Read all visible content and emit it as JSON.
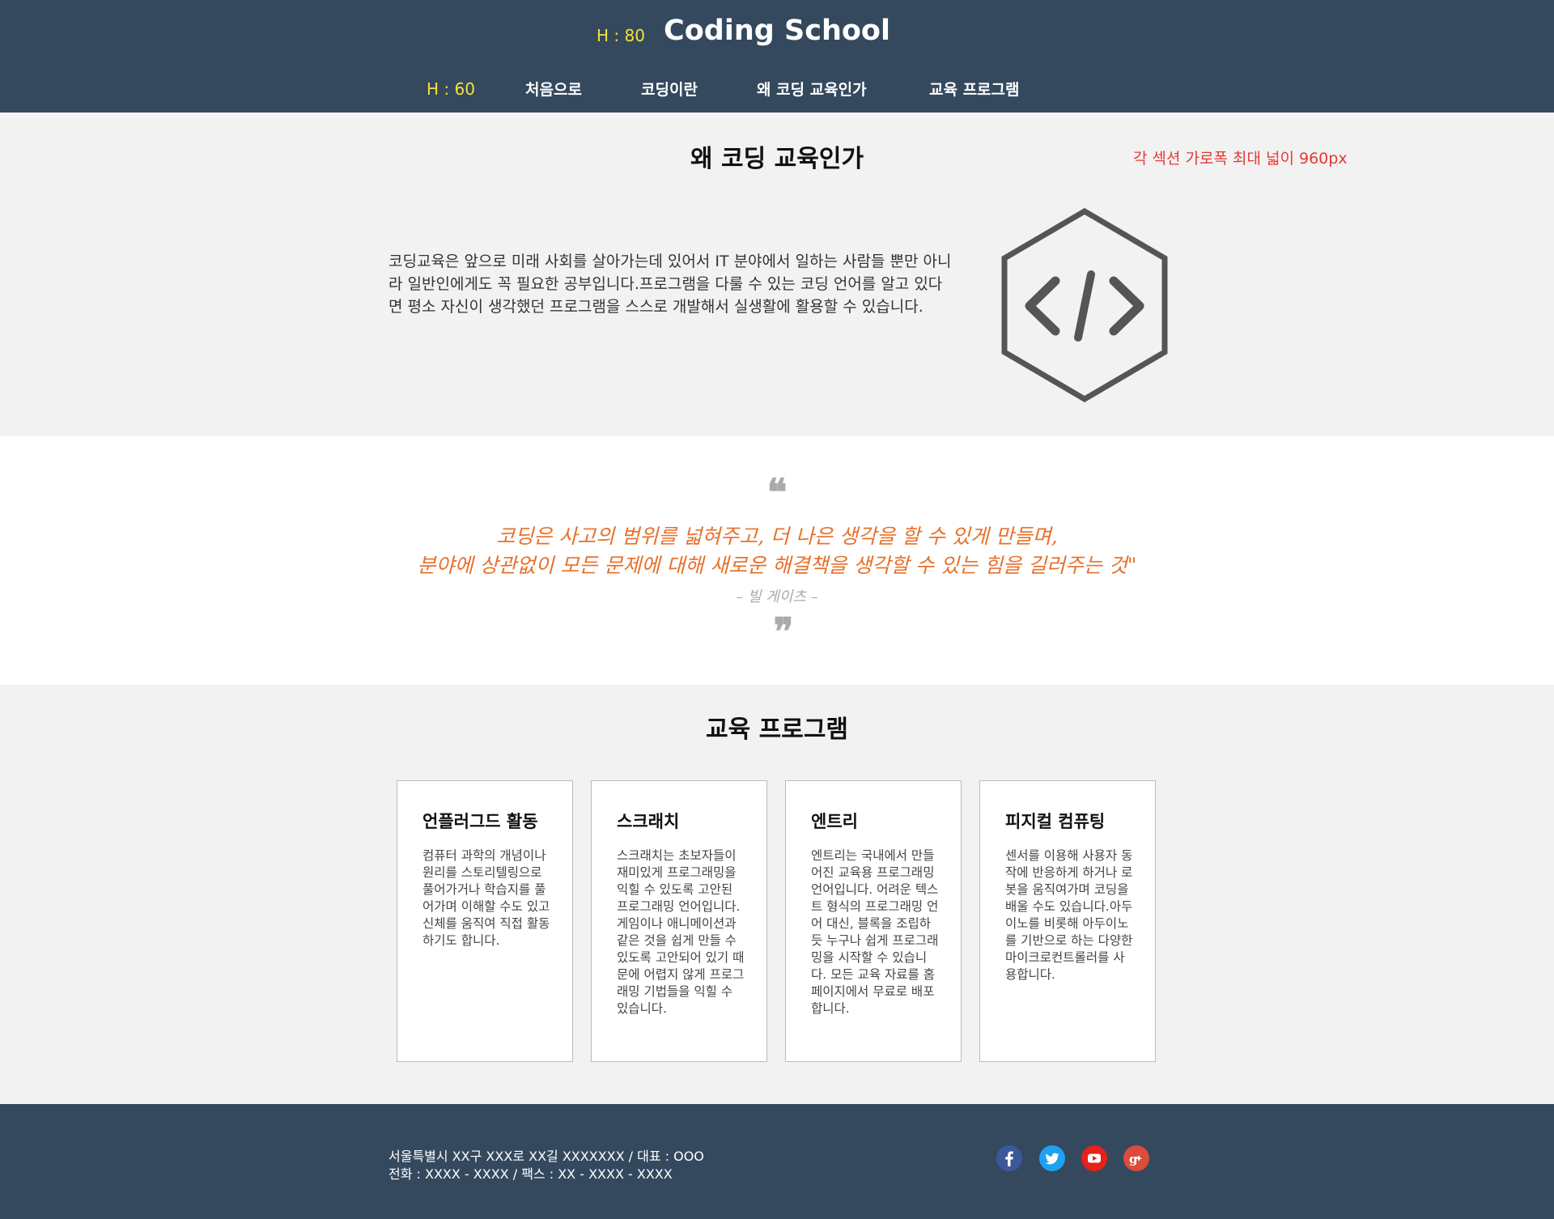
{
  "header": {
    "site_title": "Coding School",
    "height_note_header": "H : 80",
    "height_note_nav": "H : 60",
    "nav": [
      {
        "label": "처음으로"
      },
      {
        "label": "코딩이란"
      },
      {
        "label": "왜 코딩 교육인가"
      },
      {
        "label": "교육 프로그램"
      }
    ]
  },
  "why": {
    "title": "왜 코딩 교육인가",
    "width_note": "각 섹션 가로폭 최대 넓이 960px",
    "text": "코딩교육은 앞으로 미래 사회를 살아가는데 있어서 IT 분야에서 일하는 사람들 뿐만 아니라 일반인에게도 꼭 필요한 공부입니다.프로그램을 다룰 수 있는 코딩 언어를 알고 있다면 평소 자신이 생각했던 프로그램을 스스로 개발해서 실생활에 활용할 수 있습니다.",
    "icon": "code-hexagon-icon"
  },
  "quote": {
    "open_mark": "❝",
    "line1": "코딩은 사고의 범위를 넓혀주고, 더 나은 생각을 할 수 있게 만들며,",
    "line2": "분야에 상관없이 모든 문제에 대해 새로운 해결책을 생각할 수 있는 힘을 길러주는 것\"",
    "author": "– 빌 게이츠 –",
    "close_mark": "❞"
  },
  "programs": {
    "title": "교육 프로그램",
    "cards": [
      {
        "title": "언플러그드 활동",
        "desc": "컴퓨터 과학의 개념이나 원리를 스토리텔링으로 풀어가거나 학습지를 풀어가며 이해할 수도 있고 신체를 움직여 직접 활동하기도 합니다."
      },
      {
        "title": "스크래치",
        "desc": "스크래치는 초보자들이 재미있게 프로그래밍을 익힐 수 있도록 고안된 프로그래밍 언어입니다. 게임이나 애니메이션과 같은 것을 쉽게 만들 수 있도록 고안되어 있기 때문에 어렵지 않게 프로그래밍 기법들을 익힐 수 있습니다."
      },
      {
        "title": "엔트리",
        "desc": "엔트리는 국내에서 만들어진 교육용 프로그래밍 언어입니다. 어려운 텍스트 형식의 프로그래밍 언어 대신, 블록을 조립하듯 누구나 쉽게 프로그래밍을 시작할 수 있습니다. 모든 교육 자료를 홈페이지에서 무료로 배포합니다."
      },
      {
        "title": "피지컬 컴퓨팅",
        "desc": "센서를 이용해 사용자 동작에 반응하게 하거나 로봇을 움직여가며 코딩을 배울 수도 있습니다.아두이노를 비롯해 아두이노를 기반으로 하는 다양한 마이크로컨트롤러를 사용합니다."
      }
    ]
  },
  "footer": {
    "address": "서울특별시 XX구 XXX로 XX길 XXXXXXX / 대표 : OOO",
    "contact": "전화 : XXXX - XXXX / 팩스 : XX - XXXX - XXXX",
    "social": [
      {
        "name": "facebook-icon",
        "color": "#3b5998"
      },
      {
        "name": "twitter-icon",
        "color": "#1da1f2"
      },
      {
        "name": "youtube-icon",
        "color": "#e62117"
      },
      {
        "name": "google-plus-icon",
        "color": "#dd4b39"
      }
    ]
  }
}
